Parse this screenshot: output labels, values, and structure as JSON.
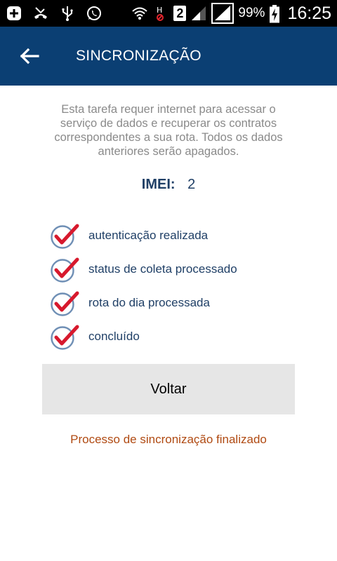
{
  "status_bar": {
    "icons_left": [
      "add-square-icon",
      "missed-call-icon",
      "usb-icon",
      "whatsapp-icon"
    ],
    "icons_right": [
      "wifi-icon",
      "h-signal-icon",
      "signal-bars-icon",
      "signal-bars-boxed-icon",
      "battery-charging-icon"
    ],
    "sim_number": "2",
    "battery_percent": "99%",
    "time": "16:25"
  },
  "app_bar": {
    "title": "SINCRONIZAÇÃO",
    "back_icon": "arrow-left-icon",
    "background_color": "#0b3f73"
  },
  "description": "Esta tarefa requer internet para acessar o serviço de dados e recuperar os contratos correspondentes a sua rota. Todos os dados anteriores serão apagados.",
  "imei": {
    "label": "IMEI:",
    "value": "2"
  },
  "steps": [
    {
      "label": "autenticação realizada",
      "icon": "check-circle-icon"
    },
    {
      "label": "status de coleta processado",
      "icon": "check-circle-icon"
    },
    {
      "label": "rota do dia processada",
      "icon": "check-circle-icon"
    },
    {
      "label": "concluído",
      "icon": "check-circle-icon"
    }
  ],
  "button": {
    "voltar_label": "Voltar"
  },
  "final_status": "Processo de sincronização finalizado",
  "colors": {
    "accent_check": "#d7192d",
    "circle": "#6f8fb5",
    "status_text": "#b04a12"
  }
}
